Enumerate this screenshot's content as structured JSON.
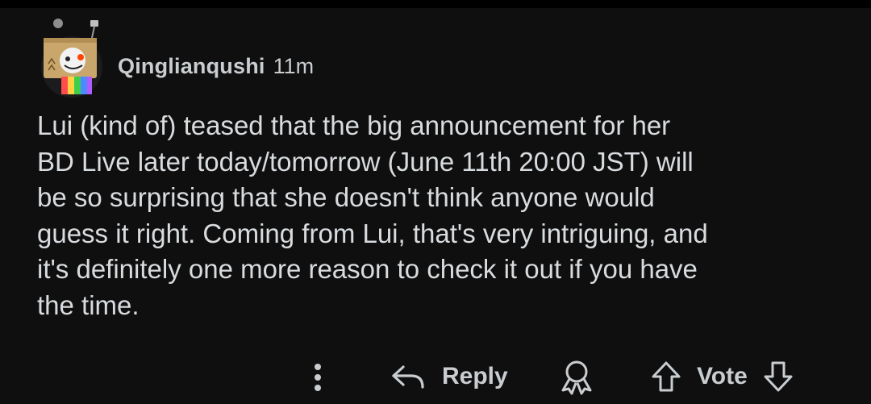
{
  "comment": {
    "username": "Qinglianqushi",
    "time": "11m",
    "lines": [
      "Lui (kind of) teased that the big announcement for her",
      "BD Live later today/tomorrow (June 11th 20:00 JST) will",
      "be so surprising that she doesn't think anyone would",
      "guess it right. Coming from Lui, that's very intriguing, and",
      "it's definitely one more reason to check it out if you have",
      "the time."
    ]
  },
  "actions": {
    "more_icon": "more-vertical-icon",
    "reply_icon": "reply-arrow-icon",
    "reply_label": "Reply",
    "award_icon": "award-icon",
    "upvote_icon": "upvote-arrow-icon",
    "vote_label": "Vote",
    "downvote_icon": "downvote-arrow-icon"
  },
  "colors": {
    "background": "#0f0f10",
    "text": "#d9dcde",
    "muted": "#c9cdd0"
  }
}
